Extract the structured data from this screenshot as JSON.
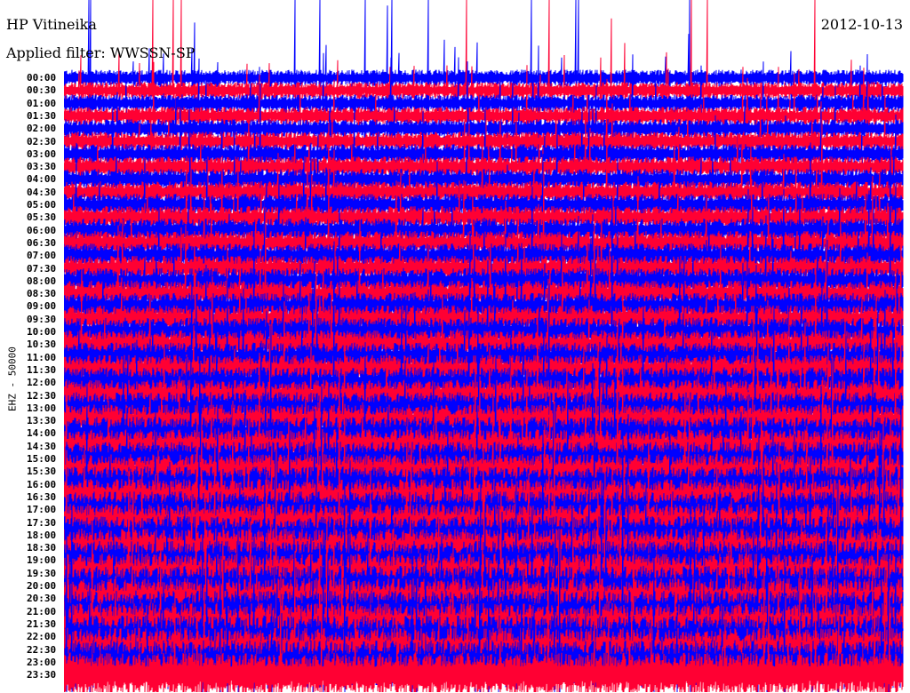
{
  "header": {
    "station": "HP Vitineika",
    "filter": "Applied filter: WWSSN-SP",
    "date": "2012-10-13"
  },
  "chart_data": {
    "type": "line",
    "title": "HP Vitineika",
    "subtitle": "Applied filter: WWSSN-SP",
    "date": "2012-10-13",
    "ylabel": "EHZ - 50000",
    "row_interval_minutes": 30,
    "row_labels": [
      "00:00",
      "00:30",
      "01:00",
      "01:30",
      "02:00",
      "02:30",
      "03:00",
      "03:30",
      "04:00",
      "04:30",
      "05:00",
      "05:30",
      "06:00",
      "06:30",
      "07:00",
      "07:30",
      "08:00",
      "08:30",
      "09:00",
      "09:30",
      "10:00",
      "10:30",
      "11:00",
      "11:30",
      "12:00",
      "12:30",
      "13:00",
      "13:30",
      "14:00",
      "14:30",
      "15:00",
      "15:30",
      "16:00",
      "16:30",
      "17:00",
      "17:30",
      "18:00",
      "18:30",
      "19:00",
      "19:30",
      "20:00",
      "20:30",
      "21:00",
      "21:30",
      "22:00",
      "22:30",
      "23:00",
      "23:30"
    ],
    "trace_colors": [
      "#0000ff",
      "#ff0033"
    ]
  }
}
